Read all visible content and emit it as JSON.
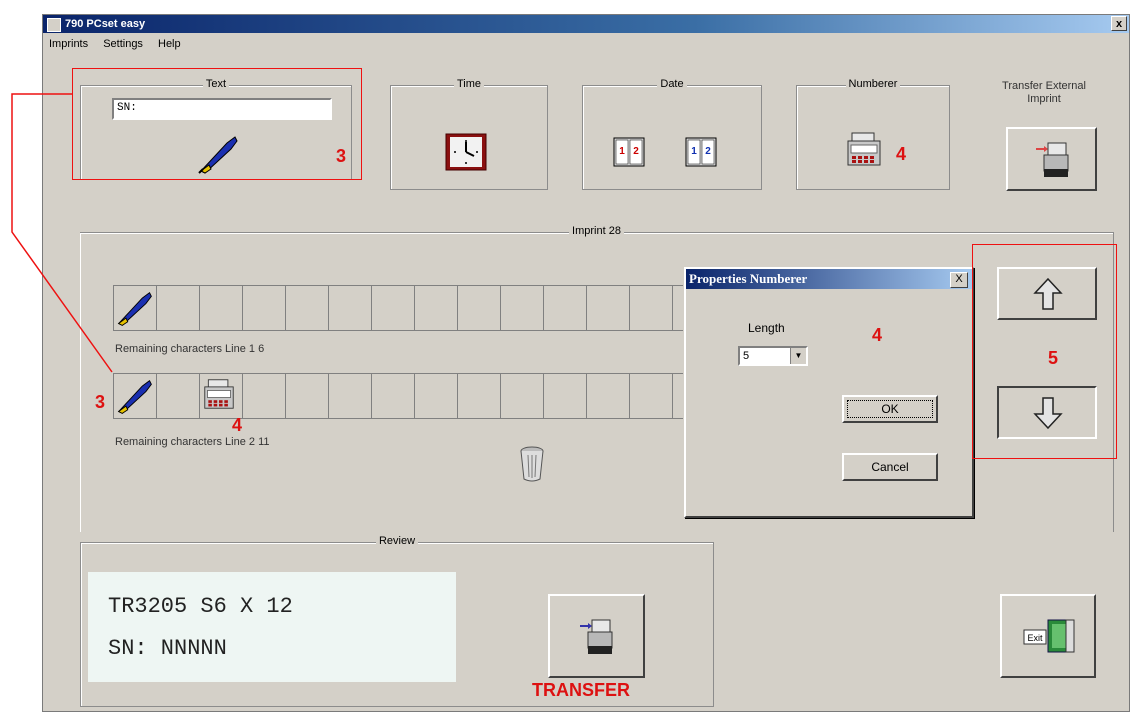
{
  "window": {
    "title": "790 PCset easy",
    "close_glyph": "x"
  },
  "menu": [
    "Imprints",
    "Settings",
    "Help"
  ],
  "top_groups": {
    "text": {
      "label": "Text",
      "value": "SN:"
    },
    "time": {
      "label": "Time"
    },
    "date": {
      "label": "Date"
    },
    "numberer": {
      "label": "Numberer"
    },
    "transfer_external": {
      "label_line1": "Transfer External",
      "label_line2": "Imprint"
    }
  },
  "imprint": {
    "label": "Imprint 28",
    "line1_remaining": "Remaining characters Line 1    6",
    "line2_remaining": "Remaining characters Line 2    11"
  },
  "dialog": {
    "title": "Properties Numberer",
    "close_glyph": "X",
    "length_label": "Length",
    "length_value": "5",
    "ok_label": "OK",
    "cancel_label": "Cancel"
  },
  "review": {
    "label": "Review",
    "line1": "TR3205 S6 X 12",
    "line2": "SN: NNNNN"
  },
  "buttons": {
    "exit_label": "Exit"
  },
  "annotations": {
    "n3_a": "3",
    "n3_b": "3",
    "n4_a": "4",
    "n4_b": "4",
    "n4_c": "4",
    "n5": "5",
    "transfer": "TRANSFER"
  },
  "colors": {
    "annotation_red": "#dd1111",
    "titlebar": "#0a246a",
    "window_bg": "#d4d0c8"
  },
  "icons": {
    "text": "pen-icon",
    "time": "clock-icon",
    "date": "calendar-icon",
    "numberer": "numberer-icon",
    "transfer": "printer-transfer-icon",
    "up": "arrow-up-icon",
    "down": "arrow-down-icon",
    "trash": "trash-icon",
    "exit": "exit-door-icon"
  }
}
